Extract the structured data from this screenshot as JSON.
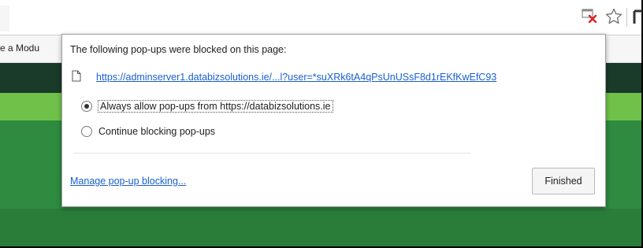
{
  "bookmarks_bar": {
    "partial_item": "e a Modu"
  },
  "popup": {
    "title": "The following pop-ups were blocked on this page:",
    "blocked_url": "https://adminserver1.databizsolutions.ie/...l?user=*suXRk6tA4qPsUnUSsF8d1rEKfKwEfC93",
    "options": [
      {
        "label": "Always allow pop-ups from https://databizsolutions.ie",
        "selected": true
      },
      {
        "label": "Continue blocking pop-ups",
        "selected": false
      }
    ],
    "manage_link": "Manage pop-up blocking...",
    "finished_label": "Finished"
  },
  "colors": {
    "link": "#1a5fd0",
    "site_header": "#1a3a2a",
    "site_strip": "#6fc14a",
    "site_body": "#2e8b3f",
    "blocked_icon_x": "#e02020"
  },
  "icons": [
    "popup-blocked-icon",
    "bookmark-star-icon",
    "document-icon",
    "extension-icon"
  ]
}
